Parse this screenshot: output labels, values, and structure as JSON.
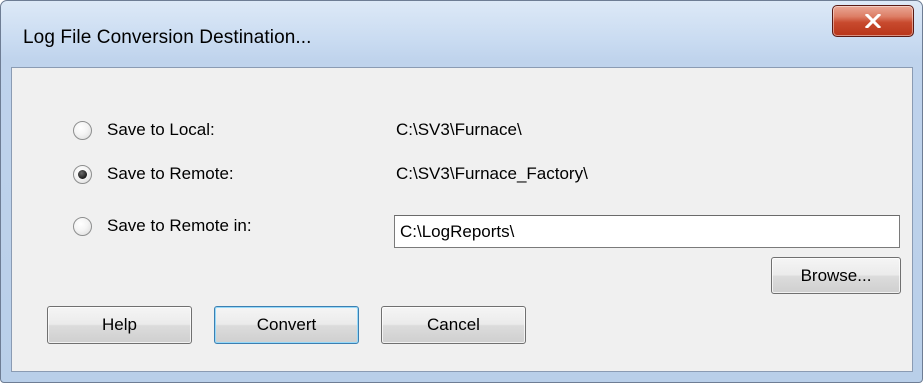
{
  "window": {
    "title": "Log File Conversion Destination...",
    "close_icon": "close-icon"
  },
  "options": [
    {
      "label": "Save to Local:",
      "path": "C:\\SV3\\Furnace\\",
      "selected": false
    },
    {
      "label": "Save to Remote:",
      "path": "C:\\SV3\\Furnace_Factory\\",
      "selected": true
    },
    {
      "label": "Save to Remote in:",
      "path_input_value": "C:\\LogReports\\",
      "selected": false
    }
  ],
  "buttons": {
    "browse": "Browse...",
    "help": "Help",
    "convert": "Convert",
    "cancel": "Cancel"
  },
  "colors": {
    "close_button": "#c84a2e",
    "client_background": "#f0f0f0",
    "frame": "#bfd3ec"
  }
}
